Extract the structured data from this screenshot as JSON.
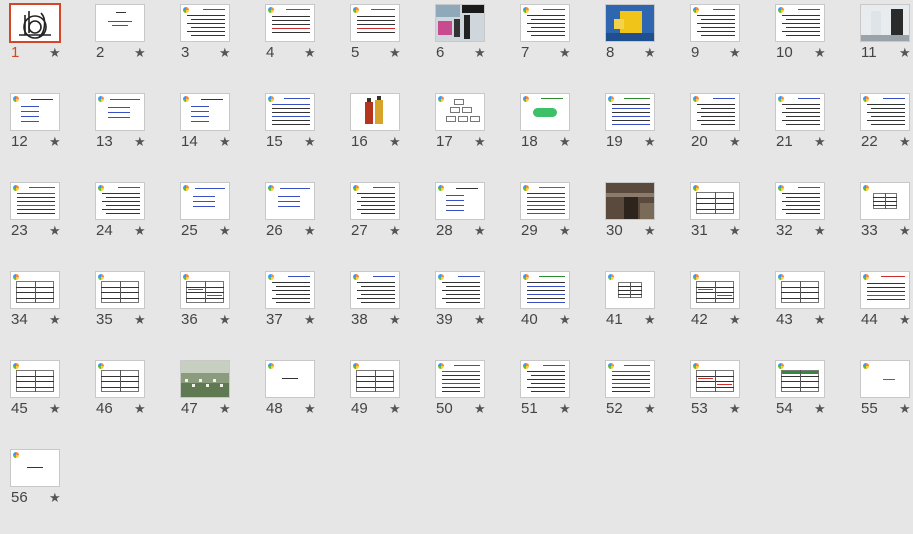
{
  "selected_slide": 1,
  "slides": [
    {
      "num": "1",
      "kind": "calligraphy"
    },
    {
      "num": "2",
      "kind": "title"
    },
    {
      "num": "3",
      "kind": "text"
    },
    {
      "num": "4",
      "kind": "text-red"
    },
    {
      "num": "5",
      "kind": "text-red"
    },
    {
      "num": "6",
      "kind": "photo-people"
    },
    {
      "num": "7",
      "kind": "text"
    },
    {
      "num": "8",
      "kind": "photo-puzzle"
    },
    {
      "num": "9",
      "kind": "text"
    },
    {
      "num": "10",
      "kind": "text"
    },
    {
      "num": "11",
      "kind": "photo-chess"
    },
    {
      "num": "12",
      "kind": "list"
    },
    {
      "num": "13",
      "kind": "list-blue"
    },
    {
      "num": "14",
      "kind": "list"
    },
    {
      "num": "15",
      "kind": "text-blue"
    },
    {
      "num": "16",
      "kind": "image-bottles"
    },
    {
      "num": "17",
      "kind": "diagram"
    },
    {
      "num": "18",
      "kind": "green-shape"
    },
    {
      "num": "19",
      "kind": "text-green"
    },
    {
      "num": "20",
      "kind": "text"
    },
    {
      "num": "21",
      "kind": "text"
    },
    {
      "num": "22",
      "kind": "text"
    },
    {
      "num": "23",
      "kind": "text-blue"
    },
    {
      "num": "24",
      "kind": "text"
    },
    {
      "num": "25",
      "kind": "list-blue"
    },
    {
      "num": "26",
      "kind": "list-blue"
    },
    {
      "num": "27",
      "kind": "text"
    },
    {
      "num": "28",
      "kind": "list"
    },
    {
      "num": "29",
      "kind": "text-green"
    },
    {
      "num": "30",
      "kind": "photo-cliff"
    },
    {
      "num": "31",
      "kind": "table"
    },
    {
      "num": "32",
      "kind": "text"
    },
    {
      "num": "33",
      "kind": "table-small"
    },
    {
      "num": "34",
      "kind": "table"
    },
    {
      "num": "35",
      "kind": "table"
    },
    {
      "num": "36",
      "kind": "table-red"
    },
    {
      "num": "37",
      "kind": "text"
    },
    {
      "num": "38",
      "kind": "text"
    },
    {
      "num": "39",
      "kind": "text"
    },
    {
      "num": "40",
      "kind": "text-green"
    },
    {
      "num": "41",
      "kind": "table-small"
    },
    {
      "num": "42",
      "kind": "table-red"
    },
    {
      "num": "43",
      "kind": "table"
    },
    {
      "num": "44",
      "kind": "text-red"
    },
    {
      "num": "45",
      "kind": "table"
    },
    {
      "num": "46",
      "kind": "table"
    },
    {
      "num": "47",
      "kind": "photo-flowers"
    },
    {
      "num": "48",
      "kind": "single-line"
    },
    {
      "num": "49",
      "kind": "table"
    },
    {
      "num": "50",
      "kind": "text-blue"
    },
    {
      "num": "51",
      "kind": "text"
    },
    {
      "num": "52",
      "kind": "text-blue"
    },
    {
      "num": "53",
      "kind": "table-red"
    },
    {
      "num": "54",
      "kind": "table-green"
    },
    {
      "num": "55",
      "kind": "single-green"
    },
    {
      "num": "56",
      "kind": "single-line"
    }
  ],
  "star_glyph": "★",
  "colors": {
    "selection": "#d24726",
    "background": "#e6e6e6"
  }
}
